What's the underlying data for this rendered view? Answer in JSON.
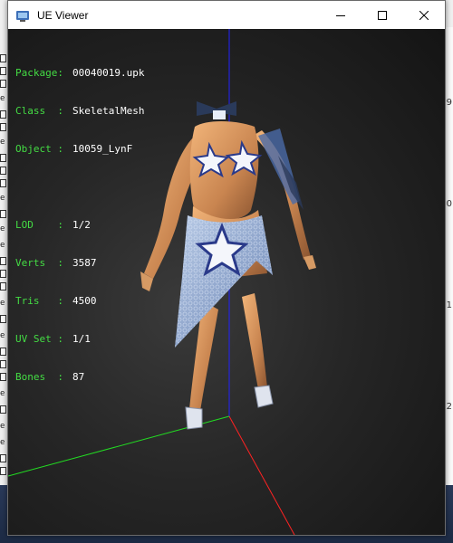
{
  "window": {
    "title": "UE Viewer",
    "buttons": {
      "minimize": "minimize-icon",
      "maximize": "maximize-icon",
      "close": "close-icon"
    }
  },
  "hud": {
    "package_label": "Package:",
    "package_value": "00040019.upk",
    "class_label": "Class  :",
    "class_value": "SkeletalMesh",
    "object_label": "Object :",
    "object_value": "10059_LynF",
    "lod_label": "LOD    :",
    "lod_value": "1/2",
    "verts_label": "Verts  :",
    "verts_value": "3587",
    "tris_label": "Tris   :",
    "tris_value": "4500",
    "uvset_label": "UV Set :",
    "uvset_value": "1/1",
    "bones_label": "Bones  :",
    "bones_value": "87"
  },
  "background_app": {
    "left_glyphs": [
      "e",
      "e",
      "e",
      "e",
      "e",
      "e",
      "e",
      "e",
      "e",
      "e"
    ],
    "right_numbers": [
      "9",
      "0",
      "1",
      "2"
    ]
  },
  "colors": {
    "hud_label": "#44dd44",
    "hud_value": "#ffffff",
    "axis_x": "#ff2222",
    "axis_y": "#22dd22",
    "axis_z": "#2222ff"
  }
}
